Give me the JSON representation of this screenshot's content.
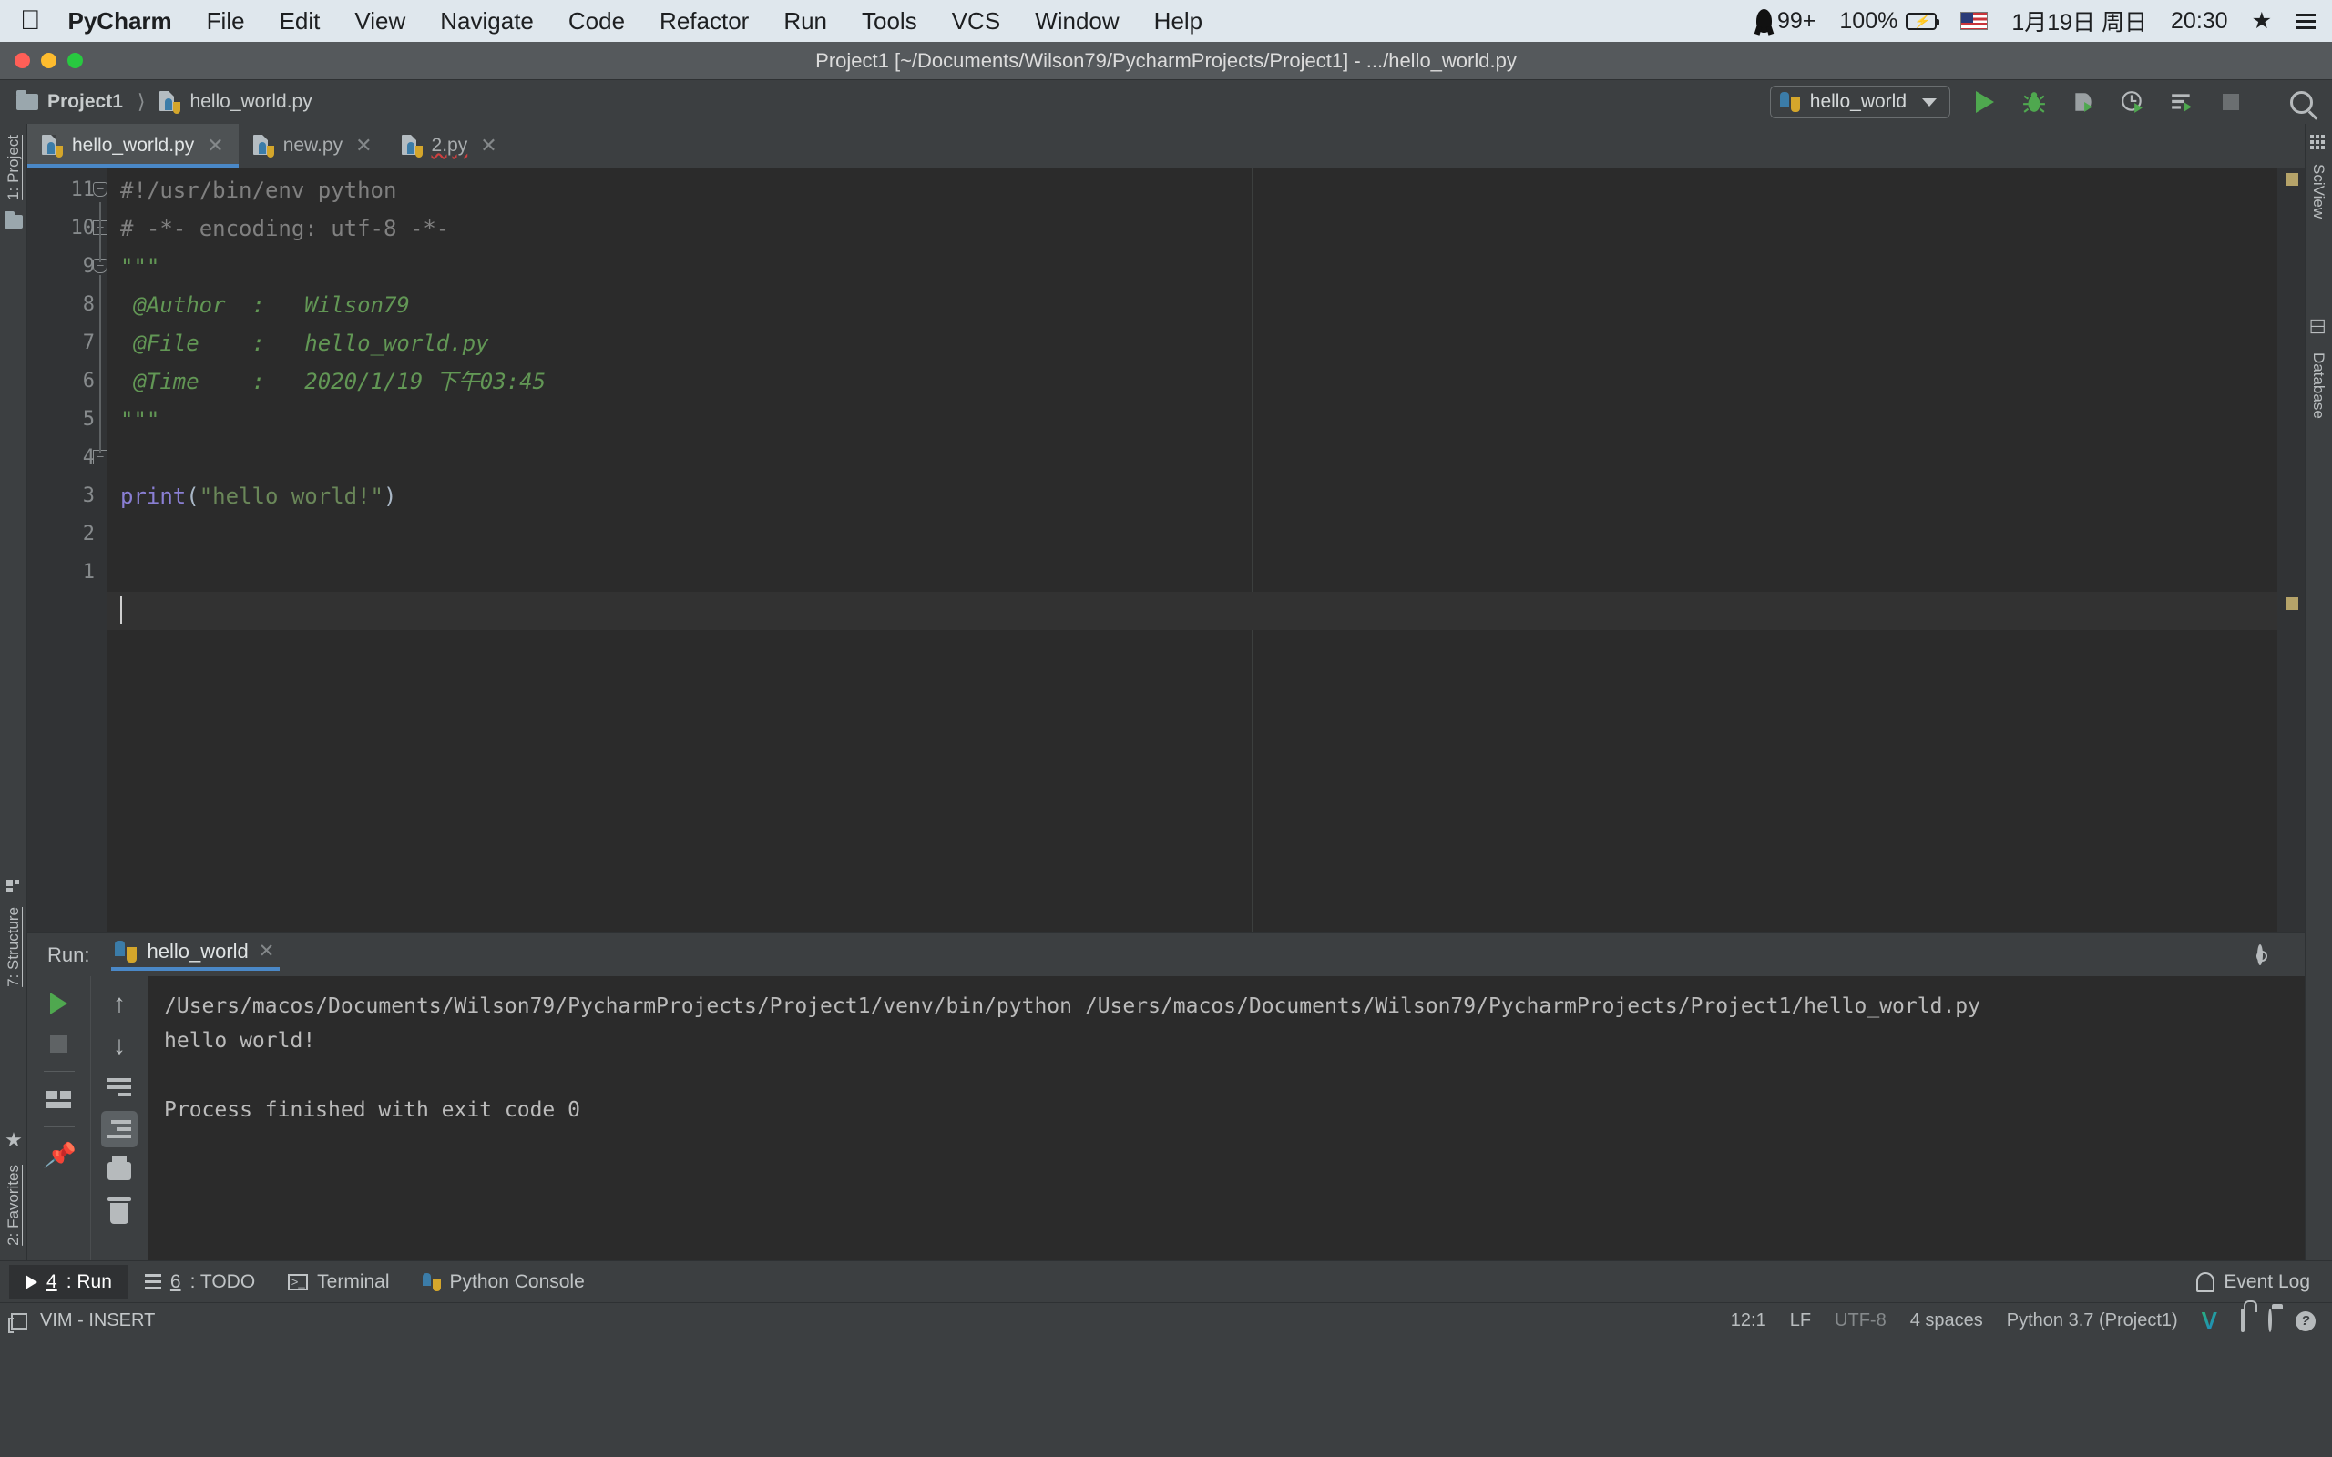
{
  "mac_menubar": {
    "apple_icon": "apple-icon",
    "items": [
      {
        "label": "PyCharm",
        "bold": true
      },
      {
        "label": "File",
        "bold": false
      },
      {
        "label": "Edit",
        "bold": false
      },
      {
        "label": "View",
        "bold": false
      },
      {
        "label": "Navigate",
        "bold": false
      },
      {
        "label": "Code",
        "bold": false
      },
      {
        "label": "Refactor",
        "bold": false
      },
      {
        "label": "Run",
        "bold": false
      },
      {
        "label": "Tools",
        "bold": false
      },
      {
        "label": "VCS",
        "bold": false
      },
      {
        "label": "Window",
        "bold": false
      },
      {
        "label": "Help",
        "bold": false
      }
    ],
    "status": {
      "qq_badge": "99+",
      "battery_percent": "100%",
      "battery_icon": "battery-charging-icon",
      "input_source": "us-flag-icon",
      "date": "1月19日 周日",
      "time": "20:30",
      "star_icon": "star-icon",
      "menu_list_icon": "list-icon"
    }
  },
  "window": {
    "title": "Project1 [~/Documents/Wilson79/PycharmProjects/Project1] - .../hello_world.py",
    "traffic_lights": [
      "close-red",
      "minimize-yellow",
      "maximize-green"
    ]
  },
  "navbar": {
    "breadcrumb": [
      {
        "label": "Project1",
        "icon": "folder-icon"
      },
      {
        "label": "hello_world.py",
        "icon": "python-file-icon"
      }
    ],
    "run_config": {
      "name": "hello_world",
      "icon": "python-icon",
      "chevron": "chevron-down-icon"
    },
    "buttons": [
      {
        "name": "run-button",
        "icon": "play-icon"
      },
      {
        "name": "debug-button",
        "icon": "bug-icon"
      },
      {
        "name": "run-coverage-button",
        "icon": "coverage-icon"
      },
      {
        "name": "profile-button",
        "icon": "profile-icon"
      },
      {
        "name": "run-with-console-button",
        "icon": "run-console-icon"
      },
      {
        "name": "stop-button",
        "icon": "stop-icon"
      },
      {
        "name": "search-everywhere-button",
        "icon": "search-icon"
      }
    ]
  },
  "left_rail": [
    {
      "label": "1: Project",
      "icon": "folder-icon"
    },
    {
      "label": "7: Structure",
      "icon": "structure-icon"
    },
    {
      "label": "2: Favorites",
      "icon": "star-icon"
    }
  ],
  "right_rail": [
    {
      "label": "SciView",
      "icon": "grid-icon"
    },
    {
      "label": "Database",
      "icon": "database-icon"
    }
  ],
  "editor": {
    "tabs": [
      {
        "label": "hello_world.py",
        "icon": "python-file-icon",
        "active": true,
        "error": false
      },
      {
        "label": "new.py",
        "icon": "python-file-icon",
        "active": false,
        "error": false
      },
      {
        "label": "2.py",
        "icon": "python-file-icon",
        "active": false,
        "error": true
      }
    ],
    "line_numbers": [
      "11",
      "10",
      "9",
      "8",
      "7",
      "6",
      "5",
      "4",
      "3",
      "2",
      "1",
      ""
    ],
    "lines": [
      {
        "n": "11",
        "tokens": [
          {
            "t": "#!/usr/bin/env python",
            "c": "cmt"
          }
        ]
      },
      {
        "n": "10",
        "tokens": [
          {
            "t": "# -*- encoding: utf-8 -*-",
            "c": "cmt"
          }
        ]
      },
      {
        "n": "9",
        "tokens": [
          {
            "t": "\"\"\"",
            "c": "doc"
          }
        ]
      },
      {
        "n": "8",
        "tokens": [
          {
            "t": "@Author  :   Wilson79",
            "c": "doc"
          }
        ]
      },
      {
        "n": "7",
        "tokens": [
          {
            "t": "@File    :   hello_world.py",
            "c": "doc"
          }
        ]
      },
      {
        "n": "6",
        "tokens": [
          {
            "t": "@Time    :   2020/1/19 下午03:45",
            "c": "doc"
          }
        ]
      },
      {
        "n": "5",
        "tokens": [
          {
            "t": "\"\"\"",
            "c": "doc"
          }
        ]
      },
      {
        "n": "4",
        "tokens": []
      },
      {
        "n": "3",
        "tokens": [
          {
            "t": "print",
            "c": "kw"
          },
          {
            "t": "(",
            "c": "punct"
          },
          {
            "t": "\"hello world!\"",
            "c": "str"
          },
          {
            "t": ")",
            "c": "punct"
          }
        ]
      },
      {
        "n": "2",
        "tokens": []
      },
      {
        "n": "1",
        "tokens": []
      },
      {
        "n": "",
        "tokens": [],
        "caret": true
      }
    ]
  },
  "run_panel": {
    "label": "Run:",
    "tab": {
      "label": "hello_world",
      "icon": "python-icon",
      "close": "close-icon"
    },
    "header_actions": [
      {
        "name": "settings-button",
        "icon": "gear-icon"
      },
      {
        "name": "hide-button",
        "icon": "minimize-icon"
      }
    ],
    "left_tools": [
      {
        "name": "rerun-button",
        "icon": "play-icon"
      },
      {
        "name": "stop-process-button",
        "icon": "stop-icon"
      },
      {
        "name": "restore-layout-button",
        "icon": "layout-icon"
      },
      {
        "name": "pin-tab-button",
        "icon": "pin-icon"
      }
    ],
    "right_tools": [
      {
        "name": "up-button",
        "icon": "arrow-up-icon"
      },
      {
        "name": "down-button",
        "icon": "arrow-down-icon"
      },
      {
        "name": "soft-wrap-button",
        "icon": "soft-wrap-icon"
      },
      {
        "name": "scroll-to-end-button",
        "icon": "scroll-end-icon",
        "selected": true
      },
      {
        "name": "print-button",
        "icon": "printer-icon"
      },
      {
        "name": "clear-all-button",
        "icon": "trash-icon"
      }
    ],
    "console_lines": [
      "/Users/macos/Documents/Wilson79/PycharmProjects/Project1/venv/bin/python /Users/macos/Documents/Wilson79/PycharmProjects/Project1/hello_world.py",
      "hello world!",
      "",
      "Process finished with exit code 0"
    ]
  },
  "bottom_bar": {
    "items": [
      {
        "label_num": "4",
        "label": ": Run",
        "icon": "play-icon",
        "active": true
      },
      {
        "label_num": "6",
        "label": ": TODO",
        "icon": "list-icon",
        "active": false
      },
      {
        "label_num": "",
        "label": "Terminal",
        "icon": "terminal-icon",
        "active": false
      },
      {
        "label_num": "",
        "label": "Python Console",
        "icon": "python-icon",
        "active": false
      }
    ],
    "event_log": {
      "label": "Event Log",
      "icon": "bell-icon"
    }
  },
  "status_bar": {
    "vim_mode": "VIM - INSERT",
    "vim_icon": "window-icon",
    "caret_position": "12:1",
    "line_separator": "LF",
    "encoding": "UTF-8",
    "indent": "4 spaces",
    "interpreter": "Python 3.7 (Project1)",
    "icons": [
      {
        "name": "vcs-branch-icon",
        "glyph": "V"
      },
      {
        "name": "lock-icon"
      },
      {
        "name": "hector-inspection-icon"
      },
      {
        "name": "help-icon"
      }
    ]
  }
}
